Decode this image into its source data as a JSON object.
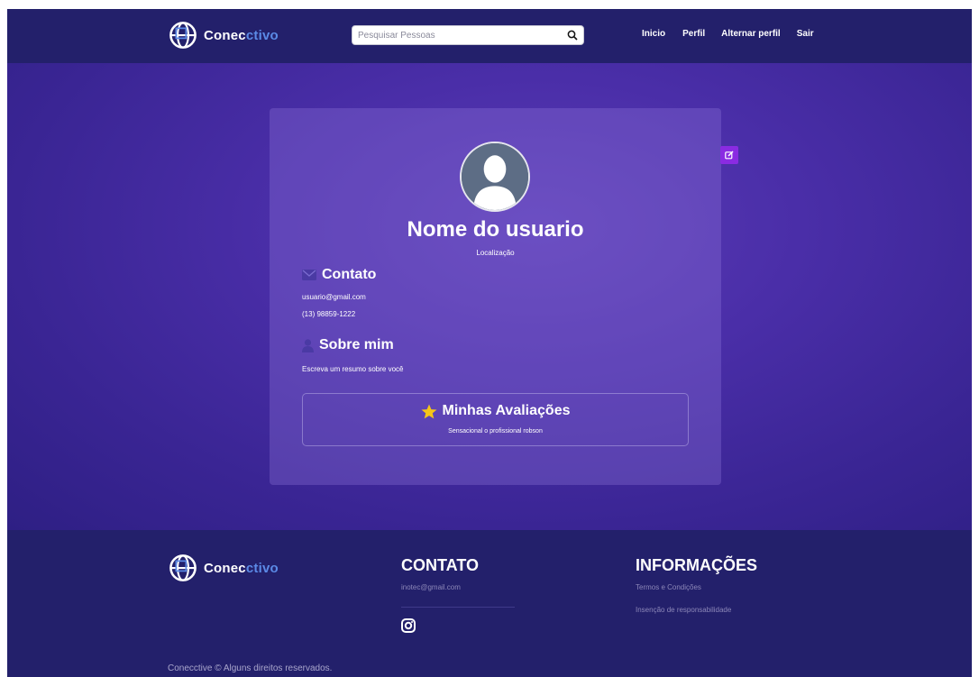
{
  "brand": {
    "name_part1": "Conec",
    "name_part2": "ctivo",
    "accent": "#5b8ae6"
  },
  "nav": {
    "search_placeholder": "Pesquisar Pessoas",
    "links": [
      "Inicio",
      "Perfil",
      "Alternar perfil",
      "Sair"
    ]
  },
  "profile": {
    "name": "Nome do usuario",
    "location": "Localização",
    "contact_title": "Contato",
    "email": "usuario@gmail.com",
    "phone": "(13) 98859-1222",
    "about_title": "Sobre mim",
    "about_text": "Escreva um resumo sobre você",
    "reviews_title": "Minhas Avaliações",
    "review_text": "Sensacional o profissional robson"
  },
  "footer": {
    "contact_heading": "CONTATO",
    "contact_email": "inotec@gmail.com",
    "info_heading": "INFORMAÇÕES",
    "terms": "Termos e Condições",
    "disclaimer": "Insenção de responsabilidade",
    "copyright": "Conecctive © Alguns direitos reservados."
  },
  "colors": {
    "navbar": "#23206b",
    "edit_button": "#8a2be2",
    "star": "#f5c518"
  }
}
